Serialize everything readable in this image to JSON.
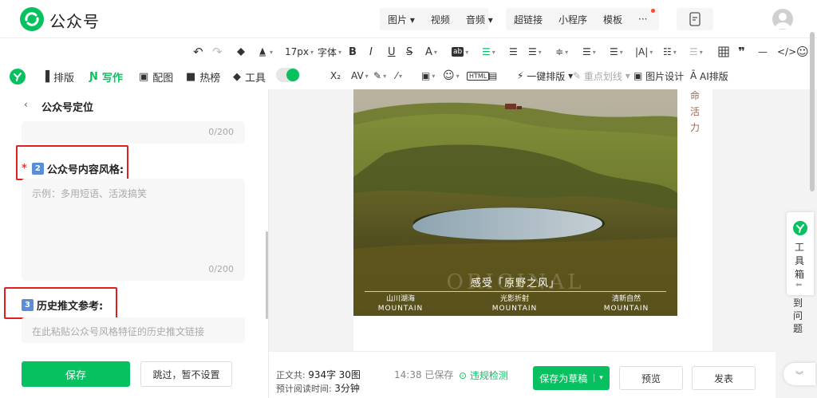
{
  "app": {
    "brand": "公众号"
  },
  "menu": {
    "group1": [
      "图片",
      "视频",
      "音频"
    ],
    "group2": [
      "超链接",
      "小程序",
      "模板"
    ],
    "more": "···"
  },
  "toolbar1": {
    "font_size": "17px",
    "font_family": "字体",
    "bold": "B",
    "italic": "I",
    "underline": "U",
    "strike": "S",
    "font_color": "A",
    "bg_color": "ab",
    "letter_spacing": "|A|",
    "quote": "❞",
    "divider": "—",
    "code": "</>",
    "emoji": "☺"
  },
  "toolbar2": {
    "subscript": "X₂",
    "letter_tool": "AV",
    "html": "HTML",
    "oneclick": "一键排版",
    "highlight": "重点划线",
    "image_design": "图片设计",
    "ai_layout": "AI排版"
  },
  "tabs": [
    {
      "label": "排版"
    },
    {
      "label": "写作"
    },
    {
      "label": "配图"
    },
    {
      "label": "热榜"
    },
    {
      "label": "工具"
    }
  ],
  "left": {
    "title": "公众号定位",
    "field0_counter": "0/200",
    "field2": {
      "number": "2",
      "label": "公众号内容风格:",
      "placeholder": "示例：多用短语、活泼搞笑",
      "counter": "0/200"
    },
    "field3": {
      "number": "3",
      "label": "历史推文参考:",
      "placeholder": "在此粘贴公众号风格特征的历史推文链接"
    },
    "save": "保存",
    "skip": "跳过，暂不设置"
  },
  "article": {
    "side_text": [
      "命",
      "活",
      "力"
    ],
    "caption": "感受「原野之风」",
    "watermark": "ORIGINAL",
    "columns": [
      {
        "cn": "山川湖海",
        "en": "MOUNTAIN"
      },
      {
        "cn": "光影折射",
        "en": "MOUNTAIN"
      },
      {
        "cn": "清新自然",
        "en": "MOUNTAIN"
      }
    ]
  },
  "right": {
    "toolbox": "工具箱",
    "faq": "到问题"
  },
  "footer": {
    "count_label": "正文共:",
    "words": "934字",
    "images": "30图",
    "read_label": "预计阅读时间:",
    "read_time": "3分钟",
    "saved": "14:38 已保存",
    "violation": "违规检测",
    "save_draft": "保存为草稿",
    "preview": "预览",
    "publish": "发表"
  },
  "colors": {
    "accent": "#07c160",
    "highlight_box": "#e02020"
  }
}
